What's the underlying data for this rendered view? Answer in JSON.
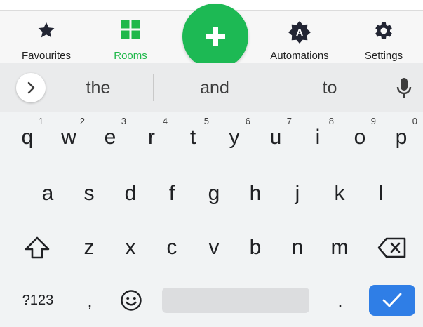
{
  "nav": {
    "items": [
      {
        "label": "Favourites",
        "icon": "star-icon"
      },
      {
        "label": "Rooms",
        "icon": "grid-icon"
      },
      {
        "label": "Automations",
        "icon": "automation-badge-icon"
      },
      {
        "label": "Settings",
        "icon": "gear-icon"
      }
    ],
    "automation_badge_letter": "A",
    "active": "Rooms",
    "fab_icon": "plus-icon",
    "colors": {
      "accent": "#1db954",
      "dark_icon": "#222533"
    }
  },
  "suggestions": {
    "words": [
      "the",
      "and",
      "to"
    ],
    "expand_icon": "chevron-right-icon",
    "mic_icon": "microphone-icon"
  },
  "keyboard": {
    "row1": [
      {
        "key": "q",
        "hint": "1"
      },
      {
        "key": "w",
        "hint": "2"
      },
      {
        "key": "e",
        "hint": "3"
      },
      {
        "key": "r",
        "hint": "4"
      },
      {
        "key": "t",
        "hint": "5"
      },
      {
        "key": "y",
        "hint": "6"
      },
      {
        "key": "u",
        "hint": "7"
      },
      {
        "key": "i",
        "hint": "8"
      },
      {
        "key": "o",
        "hint": "9"
      },
      {
        "key": "p",
        "hint": "0"
      }
    ],
    "row2": [
      "a",
      "s",
      "d",
      "f",
      "g",
      "h",
      "j",
      "k",
      "l"
    ],
    "row3": [
      "z",
      "x",
      "c",
      "v",
      "b",
      "n",
      "m"
    ],
    "shift_icon": "shift-icon",
    "backspace_icon": "backspace-icon",
    "symbols_label": "?123",
    "comma": ",",
    "emoji_icon": "emoji-icon",
    "period": ".",
    "enter_icon": "checkmark-icon",
    "enter_color": "#2f7ee6"
  }
}
